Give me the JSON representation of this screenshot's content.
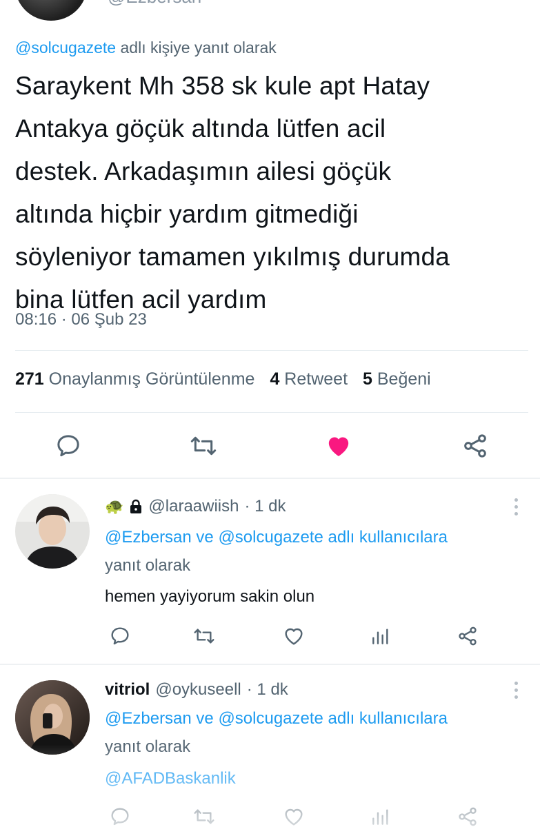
{
  "top": {
    "handle": "@Ezbersan"
  },
  "tweet": {
    "reply_to_handle": "@solcugazete",
    "reply_to_suffix": " adlı kişiye yanıt olarak",
    "text_lines": [
      "Saraykent Mh 358 sk kule apt Hatay",
      "Antakya göçük altında lütfen acil",
      "destek. Arkadaşımın ailesi göçük",
      "altında hiçbir yardım gitmediği",
      "söyleniyor tamamen yıkılmış durumda",
      "bina lütfen acil yardım"
    ],
    "timestamp": "08:16 · 06 Şub 23",
    "stats": {
      "views_count": "271",
      "views_label": "Onaylanmış Görüntülenme",
      "retweets_count": "4",
      "retweets_label": "Retweet",
      "likes_count": "5",
      "likes_label": "Beğeni"
    },
    "like_color": "#f91880"
  },
  "replies": [
    {
      "emoji": "🐢",
      "handle": "@laraawiish",
      "time": "· 1 dk",
      "replying_line1": "@Ezbersan ve @solcugazete adlı kullanıcılara",
      "replying_line2": "yanıt olarak",
      "text": "hemen yayiyorum sakin olun"
    },
    {
      "name": "vitriol",
      "handle": "@oykuseell",
      "time": "· 1 dk",
      "replying_line1": "@Ezbersan ve @solcugazete adlı kullanıcılara",
      "replying_line2": "yanıt olarak",
      "mention": "@AFADBaskanlik"
    }
  ],
  "colors": {
    "accent": "#1d9bf0",
    "text": "#0f1419",
    "secondary": "#536471",
    "like": "#f91880"
  }
}
